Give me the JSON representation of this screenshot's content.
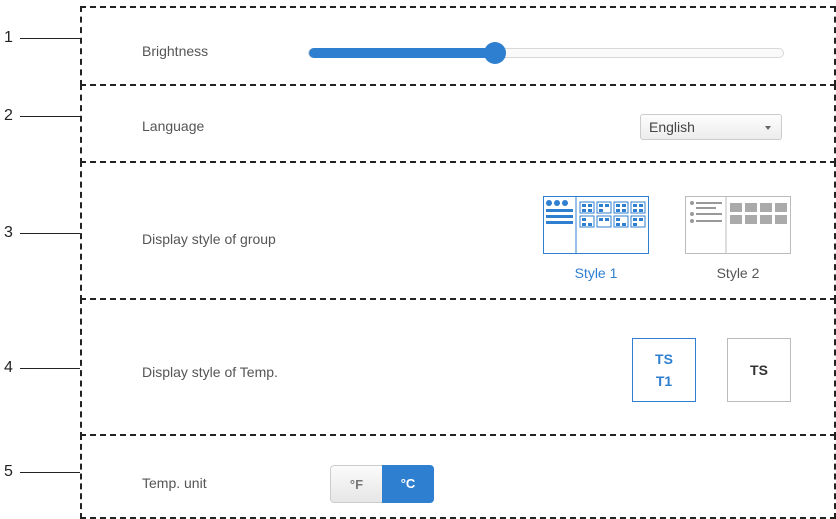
{
  "callouts": [
    "1",
    "2",
    "3",
    "4",
    "5"
  ],
  "brightness": {
    "label": "Brightness",
    "level_fraction": 0.39
  },
  "language": {
    "label": "Language",
    "selected": "English"
  },
  "group_style": {
    "label": "Display style of group",
    "options": [
      "Style 1",
      "Style 2"
    ],
    "selected_index": 0
  },
  "temp_style": {
    "label": "Display style of Temp.",
    "option1_line1": "TS",
    "option1_line2": "T1",
    "option2": "TS",
    "selected_index": 0
  },
  "temp_unit": {
    "label": "Temp. unit",
    "options": [
      "°F",
      "°C"
    ],
    "selected": "°C"
  },
  "colors": {
    "accent": "#2f7fd1",
    "border_dashed": "#222222",
    "text": "#555555"
  }
}
